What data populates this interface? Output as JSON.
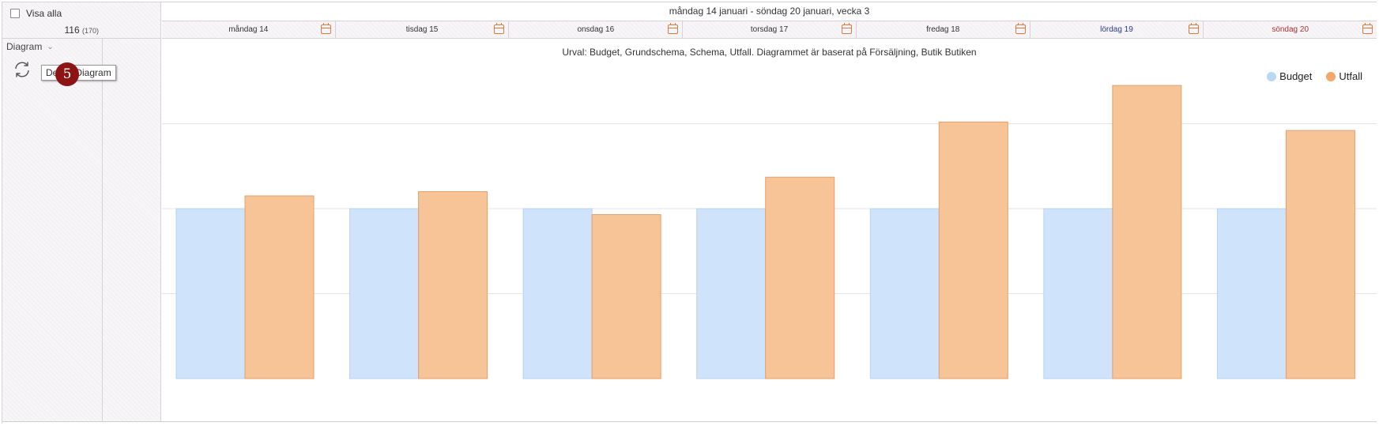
{
  "header": {
    "show_all_label": "Visa alla",
    "count_main": "116",
    "count_sub": "(170)",
    "week_title": "måndag 14 januari - söndag 20 januari, vecka 3"
  },
  "days": [
    {
      "label": "måndag 14",
      "kind": "weekday"
    },
    {
      "label": "tisdag 15",
      "kind": "weekday"
    },
    {
      "label": "onsdag 16",
      "kind": "weekday"
    },
    {
      "label": "torsdag 17",
      "kind": "weekday"
    },
    {
      "label": "fredag 18",
      "kind": "weekday"
    },
    {
      "label": "lördag 19",
      "kind": "sat"
    },
    {
      "label": "söndag 20",
      "kind": "sun"
    }
  ],
  "sidebar": {
    "section_label": "Diagram",
    "refresh_tooltip": "Diagram",
    "refresh_icon": "refresh-icon",
    "step_marker": "5"
  },
  "chart_data": {
    "type": "bar",
    "title": "Urval: Budget, Grundschema, Schema, Utfall. Diagrammet är baserat på Försäljning, Butik Butiken",
    "xlabel": "",
    "ylabel": "",
    "categories": [
      "måndag 14",
      "tisdag 15",
      "onsdag 16",
      "torsdag 17",
      "fredag 18",
      "lördag 19",
      "söndag 20"
    ],
    "ylim": [
      0,
      4
    ],
    "grid": true,
    "legend_position": "top-right",
    "series": [
      {
        "name": "Budget",
        "color": "#cfe4fb",
        "stroke": "#b5d3f5",
        "values": [
          2.0,
          2.0,
          2.0,
          2.0,
          2.0,
          2.0,
          2.0
        ]
      },
      {
        "name": "Utfall",
        "color": "#f6c496",
        "stroke": "#e4a06a",
        "values": [
          2.15,
          2.2,
          1.93,
          2.37,
          3.02,
          3.45,
          2.92
        ]
      }
    ]
  }
}
